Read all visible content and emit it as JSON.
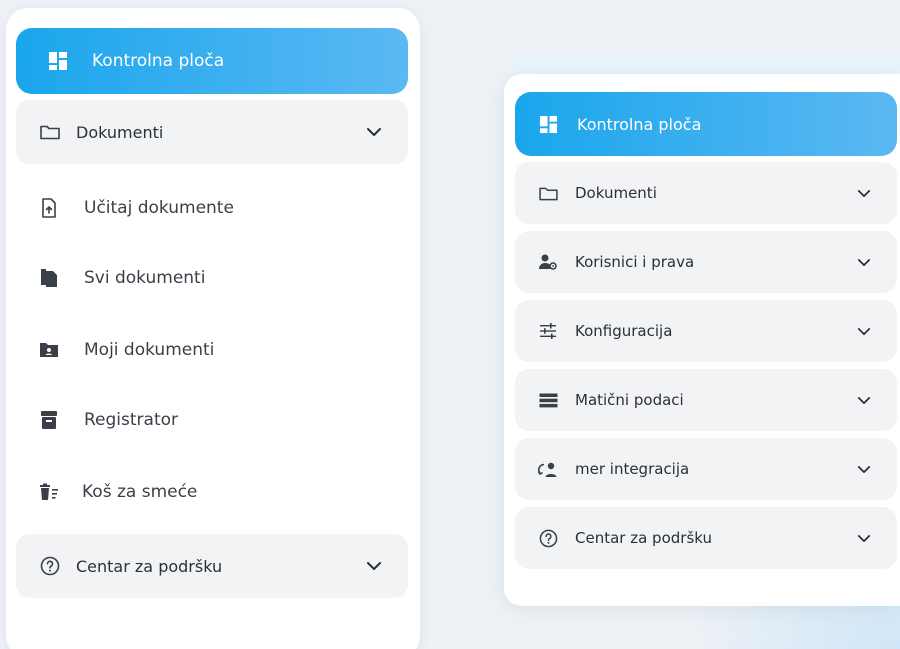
{
  "left_menu": {
    "dashboard": {
      "label": "Kontrolna ploča",
      "icon": "dashboard-icon"
    },
    "documents": {
      "label": "Dokumenti",
      "icon": "folder-icon",
      "expanded": true
    },
    "document_items": [
      {
        "label": "Učitaj dokumente",
        "icon": "upload-file-icon"
      },
      {
        "label": "Svi dokumenti",
        "icon": "file-copy-icon"
      },
      {
        "label": "Moji dokumenti",
        "icon": "folder-user-icon"
      },
      {
        "label": "Registrator",
        "icon": "archive-box-icon"
      },
      {
        "label": "Koš za smeće",
        "icon": "delete-sweep-icon"
      }
    ],
    "support": {
      "label": "Centar za podršku",
      "icon": "help-circle-icon"
    }
  },
  "right_menu": {
    "dashboard": {
      "label": "Kontrolna ploča",
      "icon": "dashboard-icon"
    },
    "groups": [
      {
        "label": "Dokumenti",
        "icon": "folder-icon"
      },
      {
        "label": "Korisnici i prava",
        "icon": "user-settings-icon"
      },
      {
        "label": "Konfiguracija",
        "icon": "sliders-icon"
      },
      {
        "label": "Matični podaci",
        "icon": "list-icon"
      },
      {
        "label": "mer integracija",
        "icon": "sync-user-icon"
      },
      {
        "label": "Centar za podršku",
        "icon": "help-circle-icon"
      }
    ]
  },
  "colors": {
    "accent_start": "#1aa6ec",
    "accent_end": "#5bb8f3",
    "group_bg": "#f2f3f5",
    "text": "#2b2f38"
  }
}
